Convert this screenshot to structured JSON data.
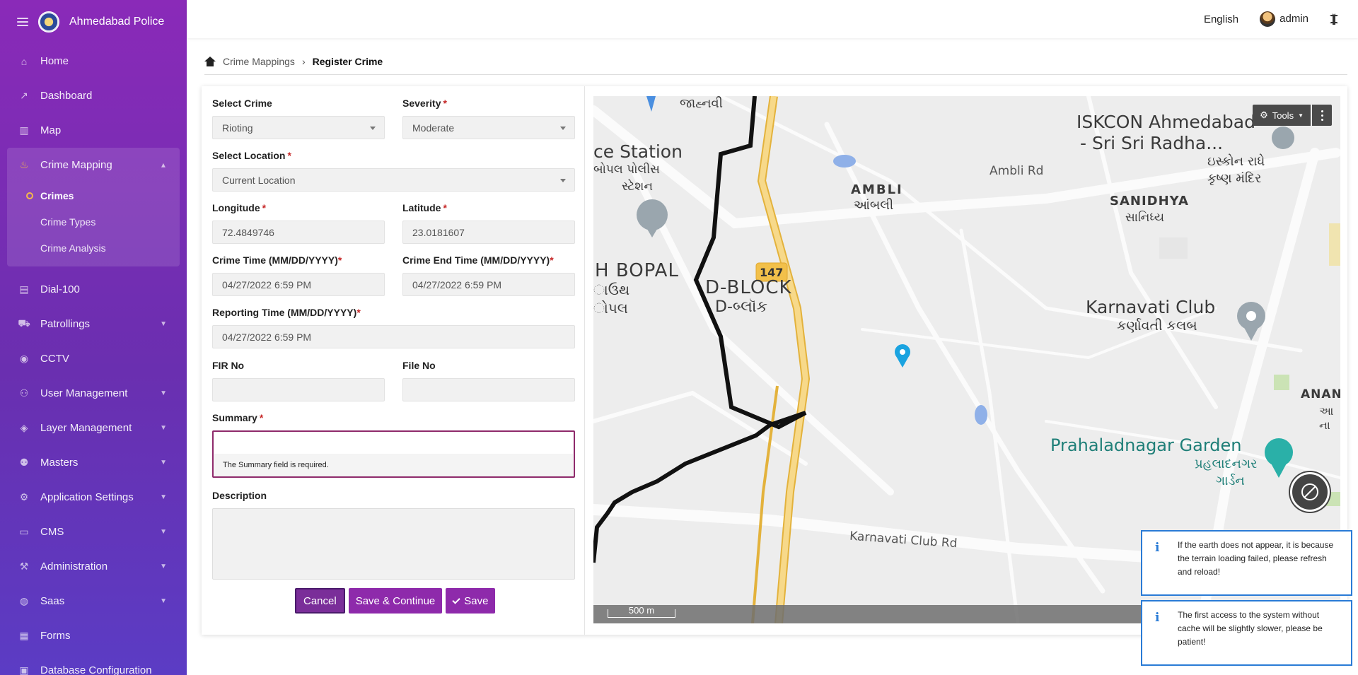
{
  "app": {
    "title": "Ahmedabad Police"
  },
  "topbar": {
    "language": "English",
    "user": "admin"
  },
  "sidebar": {
    "items": [
      {
        "label": "Home",
        "icon": "home-icon"
      },
      {
        "label": "Dashboard",
        "icon": "chart-line-icon"
      },
      {
        "label": "Map",
        "icon": "map-icon"
      }
    ],
    "crime_mapping": {
      "label": "Crime Mapping",
      "icon": "flask-icon",
      "sub": [
        "Crimes",
        "Crime Types",
        "Crime Analysis"
      ]
    },
    "items_after": [
      {
        "label": "Dial-100",
        "icon": "file-icon",
        "chev": false
      },
      {
        "label": "Patrollings",
        "icon": "car-icon",
        "chev": true
      },
      {
        "label": "CCTV",
        "icon": "camera-icon",
        "chev": false
      },
      {
        "label": "User Management",
        "icon": "users-cog-icon",
        "chev": true
      },
      {
        "label": "Layer Management",
        "icon": "layers-icon",
        "chev": true
      },
      {
        "label": "Masters",
        "icon": "users-icon",
        "chev": true
      },
      {
        "label": "Application Settings",
        "icon": "cogs-icon",
        "chev": true
      },
      {
        "label": "CMS",
        "icon": "window-icon",
        "chev": true
      },
      {
        "label": "Administration",
        "icon": "wrench-icon",
        "chev": true
      },
      {
        "label": "Saas",
        "icon": "globe-icon",
        "chev": true
      },
      {
        "label": "Forms",
        "icon": "form-icon",
        "chev": false
      },
      {
        "label": "Database Configuration",
        "icon": "database-icon",
        "chev": false
      }
    ]
  },
  "breadcrumb": {
    "parent": "Crime Mappings",
    "current": "Register Crime"
  },
  "form": {
    "select_crime": {
      "label": "Select Crime",
      "value": "Rioting"
    },
    "severity": {
      "label": "Severity",
      "value": "Moderate"
    },
    "select_location": {
      "label": "Select Location",
      "value": "Current Location"
    },
    "longitude": {
      "label": "Longitude",
      "value": "72.4849746"
    },
    "latitude": {
      "label": "Latitude",
      "value": "23.0181607"
    },
    "crime_time": {
      "label": "Crime Time (MM/DD/YYYY)",
      "value": "04/27/2022 6:59 PM"
    },
    "crime_end_time": {
      "label": "Crime End Time (MM/DD/YYYY)",
      "value": "04/27/2022 6:59 PM"
    },
    "reporting_time": {
      "label": "Reporting Time (MM/DD/YYYY)",
      "value": "04/27/2022 6:59 PM"
    },
    "fir_no": {
      "label": "FIR No",
      "value": ""
    },
    "file_no": {
      "label": "File No",
      "value": ""
    },
    "summary": {
      "label": "Summary",
      "error": "The Summary field is required."
    },
    "description": {
      "label": "Description",
      "value": ""
    },
    "required_mark": "*"
  },
  "buttons": {
    "cancel": "Cancel",
    "save_continue": "Save & Continue",
    "save": "Save"
  },
  "map": {
    "tools": "Tools",
    "scale": "500 m",
    "labels": {
      "iskcon": "ISKCON Ahmedabad",
      "iskcon2": "- Sri Sri Radha...",
      "iskcon_gu": "ઇસ્કોન રાધે",
      "iskcon_gu2": "કૃષ્ણ મંદિર",
      "ambli_rd": "Ambli Rd",
      "station": "ce Station",
      "station_gu": "બોપલ પોલીસ",
      "station_gu2": "સ્ટેશન",
      "ambli": "AMBLI",
      "ambli_gu": "આંબલી",
      "sanidhya": "SANIDHYA",
      "sanidhya_gu": "સાનિધ્ય",
      "jahnvi_gu": "જાહ્નવી",
      "road_num": "147",
      "bopal": "H BOPAL",
      "bopal_gu": "ાઉથ",
      "bopal_gu2": "ોપલ",
      "dblock": "D-BLOCK",
      "dblock_gu": "D-બ્લૉક",
      "karnavati_club": "Karnavati Club",
      "karnavati_club_gu": "કર્ણાવતી કલબ",
      "anand": "ANAND",
      "anand_gu": "આ",
      "anand_gu2": "ના",
      "prahlad": "Prahaladnagar Garden",
      "prahlad_gu": "પ્રહલાદનગર",
      "prahlad_gu2": "ગાર્ડન",
      "karnavati_rd": "Karnavati Club Rd"
    }
  },
  "toasts": [
    "If the earth does not appear, it is because the terrain loading failed, please refresh and reload!",
    "The first access to the system without cache will be slightly slower, please be patient!"
  ],
  "colors": {
    "sidebar_top": "#8a2ab8",
    "sidebar_bottom": "#5b3cc4",
    "button": "#8e2aab",
    "error_border": "#8e2a6b",
    "toast_border": "#2a7bd6"
  }
}
